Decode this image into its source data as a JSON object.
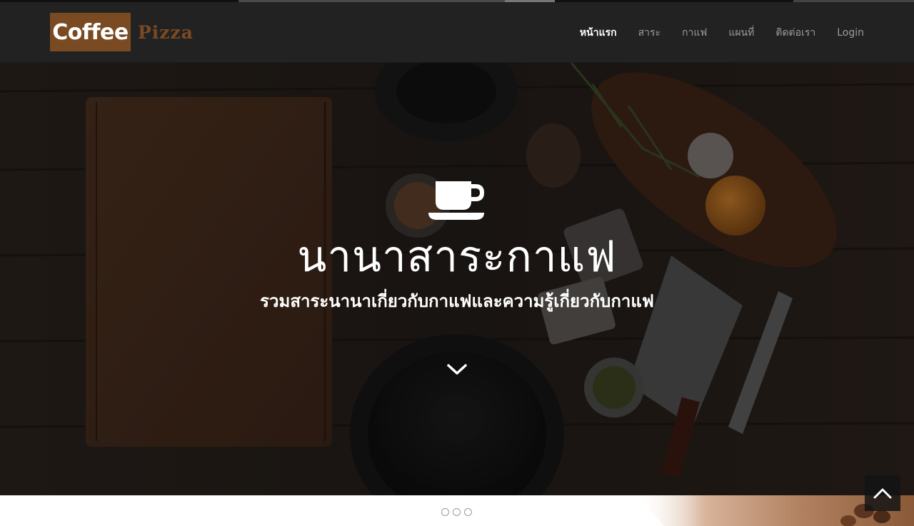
{
  "brand": {
    "logo_word_1": "Coffee",
    "logo_word_2": "Pizza",
    "logo_color": "#7a4a22"
  },
  "nav": {
    "items": [
      {
        "label": "หน้าแรก",
        "active": true
      },
      {
        "label": "สาระ",
        "active": false
      },
      {
        "label": "กาแฟ",
        "active": false
      },
      {
        "label": "แผนที่",
        "active": false
      },
      {
        "label": "ติดต่อเรา",
        "active": false
      },
      {
        "label": "Login",
        "active": false
      }
    ]
  },
  "hero": {
    "icon": "coffee-cup-icon",
    "title": "นานาสาระกาแฟ",
    "subtitle": "รวมสาระนานาเกี่ยวกับกาแฟและความรู้เกี่ยวกับกาแฟ",
    "scroll_icon": "chevron-down-icon"
  },
  "carousel": {
    "dot_count": 3
  },
  "back_to_top": {
    "icon": "chevron-up-icon"
  },
  "colors": {
    "navbar_bg": "#222222",
    "nav_text": "#9d9d9d",
    "nav_active": "#ffffff",
    "brand_brown": "#7a4a22"
  }
}
